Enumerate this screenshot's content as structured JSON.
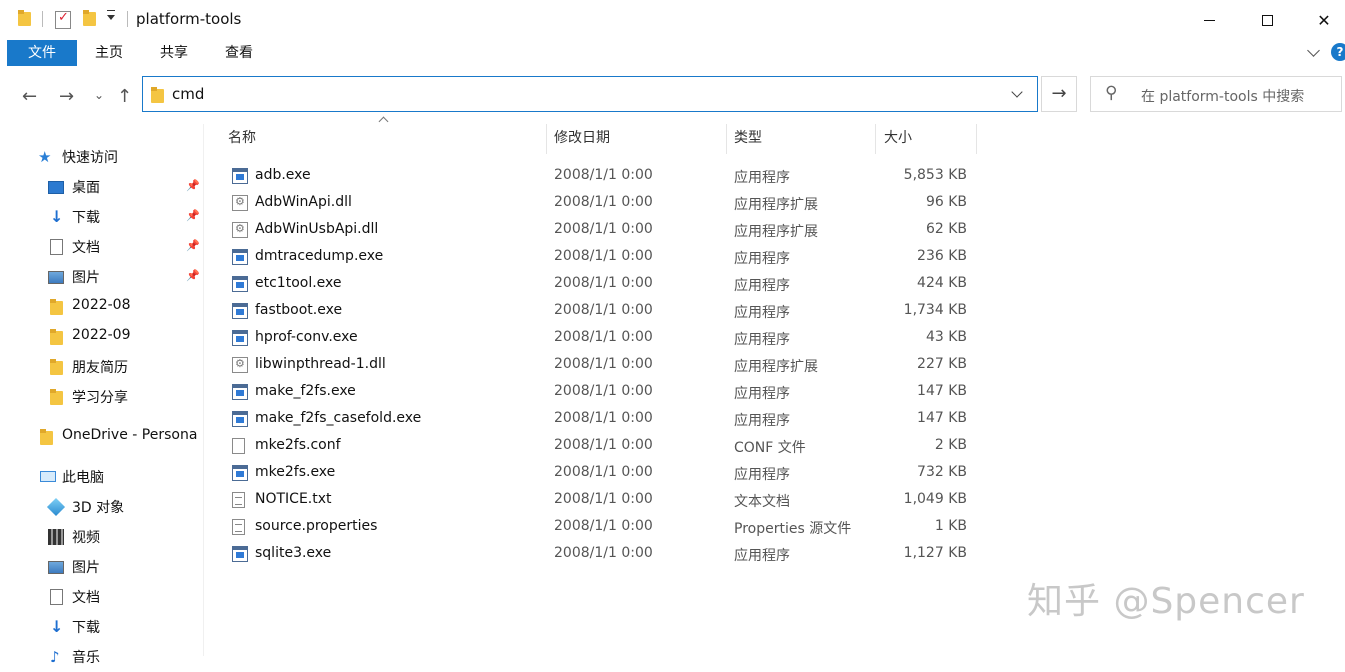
{
  "window": {
    "title": "platform-tools",
    "controls": {
      "minimize": "—",
      "maximize": "☐",
      "close": "✕"
    }
  },
  "ribbon": {
    "tabs": [
      {
        "label": "文件",
        "active": true
      },
      {
        "label": "主页"
      },
      {
        "label": "共享"
      },
      {
        "label": "查看"
      }
    ],
    "help": "?"
  },
  "nav": {
    "address": "cmd",
    "search_placeholder": "在 platform-tools 中搜索"
  },
  "sidebar": {
    "items": [
      {
        "label": "快速访问",
        "icon": "star-icon"
      },
      {
        "label": "桌面",
        "icon": "desktop-icon",
        "pinned": true
      },
      {
        "label": "下载",
        "icon": "download-icon",
        "pinned": true
      },
      {
        "label": "文档",
        "icon": "document-icon",
        "pinned": true
      },
      {
        "label": "图片",
        "icon": "picture-icon",
        "pinned": true
      },
      {
        "label": "2022-08",
        "icon": "folder-icon"
      },
      {
        "label": "2022-09",
        "icon": "folder-icon"
      },
      {
        "label": "朋友简历",
        "icon": "folder-icon"
      },
      {
        "label": "学习分享",
        "icon": "folder-icon"
      },
      {
        "label": "OneDrive - Persona",
        "icon": "folder-icon"
      },
      {
        "label": "此电脑",
        "icon": "computer-icon"
      },
      {
        "label": "3D 对象",
        "icon": "3d-objects-icon"
      },
      {
        "label": "视频",
        "icon": "video-icon"
      },
      {
        "label": "图片",
        "icon": "picture-icon"
      },
      {
        "label": "文档",
        "icon": "document-icon"
      },
      {
        "label": "下载",
        "icon": "download-icon"
      },
      {
        "label": "音乐",
        "icon": "music-icon"
      }
    ]
  },
  "columns": {
    "name": "名称",
    "date": "修改日期",
    "type": "类型",
    "size": "大小"
  },
  "files": [
    {
      "name": "adb.exe",
      "date": "2008/1/1 0:00",
      "type": "应用程序",
      "size": "5,853 KB",
      "kind": "exe"
    },
    {
      "name": "AdbWinApi.dll",
      "date": "2008/1/1 0:00",
      "type": "应用程序扩展",
      "size": "96 KB",
      "kind": "dll"
    },
    {
      "name": "AdbWinUsbApi.dll",
      "date": "2008/1/1 0:00",
      "type": "应用程序扩展",
      "size": "62 KB",
      "kind": "dll"
    },
    {
      "name": "dmtracedump.exe",
      "date": "2008/1/1 0:00",
      "type": "应用程序",
      "size": "236 KB",
      "kind": "exe"
    },
    {
      "name": "etc1tool.exe",
      "date": "2008/1/1 0:00",
      "type": "应用程序",
      "size": "424 KB",
      "kind": "exe"
    },
    {
      "name": "fastboot.exe",
      "date": "2008/1/1 0:00",
      "type": "应用程序",
      "size": "1,734 KB",
      "kind": "exe"
    },
    {
      "name": "hprof-conv.exe",
      "date": "2008/1/1 0:00",
      "type": "应用程序",
      "size": "43 KB",
      "kind": "exe"
    },
    {
      "name": "libwinpthread-1.dll",
      "date": "2008/1/1 0:00",
      "type": "应用程序扩展",
      "size": "227 KB",
      "kind": "dll"
    },
    {
      "name": "make_f2fs.exe",
      "date": "2008/1/1 0:00",
      "type": "应用程序",
      "size": "147 KB",
      "kind": "exe"
    },
    {
      "name": "make_f2fs_casefold.exe",
      "date": "2008/1/1 0:00",
      "type": "应用程序",
      "size": "147 KB",
      "kind": "exe"
    },
    {
      "name": "mke2fs.conf",
      "date": "2008/1/1 0:00",
      "type": "CONF 文件",
      "size": "2 KB",
      "kind": "blank"
    },
    {
      "name": "mke2fs.exe",
      "date": "2008/1/1 0:00",
      "type": "应用程序",
      "size": "732 KB",
      "kind": "exe"
    },
    {
      "name": "NOTICE.txt",
      "date": "2008/1/1 0:00",
      "type": "文本文档",
      "size": "1,049 KB",
      "kind": "txt"
    },
    {
      "name": "source.properties",
      "date": "2008/1/1 0:00",
      "type": "Properties 源文件",
      "size": "1 KB",
      "kind": "txt"
    },
    {
      "name": "sqlite3.exe",
      "date": "2008/1/1 0:00",
      "type": "应用程序",
      "size": "1,127 KB",
      "kind": "exe"
    }
  ],
  "watermark": "知乎 @Spencer"
}
